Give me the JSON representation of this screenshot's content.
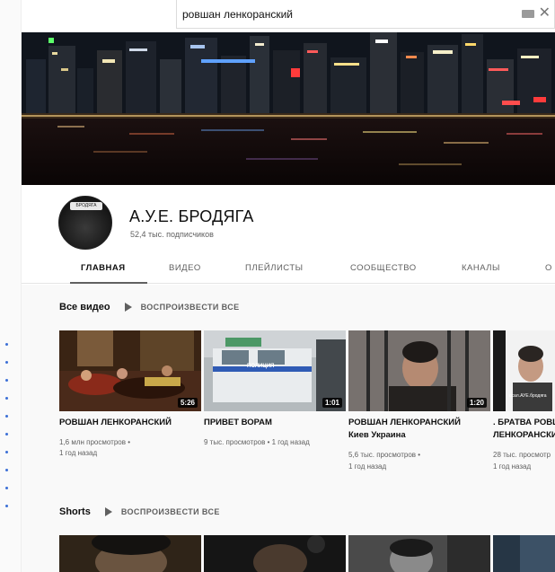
{
  "search": {
    "query": "ровшан ленкоранский"
  },
  "channel": {
    "name": "А.У.Е. БРОДЯГА",
    "subscribers": "52,4 тыс. подписчиков",
    "avatar_badge": "БРОДЯГА"
  },
  "tabs": [
    "ГЛАВНАЯ",
    "ВИДЕО",
    "ПЛЕЙЛИСТЫ",
    "СООБЩЕСТВО",
    "КАНАЛЫ",
    "О"
  ],
  "active_tab": "ГЛАВНАЯ",
  "sections": [
    {
      "title": "Все видео",
      "play_all": "ВОСПРОИЗВЕСТИ ВСЕ"
    },
    {
      "title": "Shorts",
      "play_all": "ВОСПРОИЗВЕСТИ ВСЕ"
    }
  ],
  "videos": [
    {
      "title": "РОВШАН ЛЕНКОРАНСКИЙ",
      "title2": "",
      "duration": "5:26",
      "views": "1,6 млн просмотров •",
      "age": "1 год назад"
    },
    {
      "title": "ПРИВЕТ ВОРАМ",
      "title2": "",
      "duration": "1:01",
      "views": "9 тыс. просмотров • 1 год назад",
      "age": ""
    },
    {
      "title": "РОВШАН ЛЕНКОРАНСКИЙ",
      "title2": "Киев Украина",
      "duration": "1:20",
      "views": "5,6 тыс. просмотров •",
      "age": "1 год назад"
    },
    {
      "title": ". БРАТВА РОВШ",
      "title2": "ЛЕНКОРАНСКИ",
      "duration": "",
      "views": "28 тыс. просмотр",
      "age": "1 год назад"
    }
  ],
  "thumb_texts": {
    "police": "ПОЛИЦИЯ",
    "watermark": "ссал.АУЕ.бродяга"
  },
  "colors": {
    "accent": "#0f0f0f",
    "secondary_text": "#606060",
    "link": "#3b6fd6"
  }
}
